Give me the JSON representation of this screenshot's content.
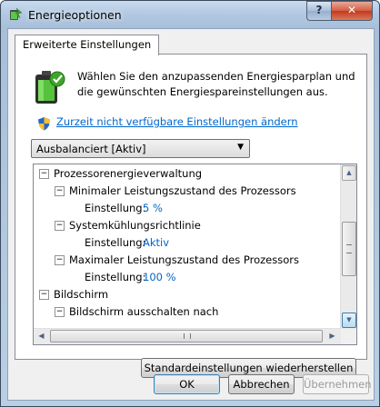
{
  "window": {
    "title": "Energieoptionen",
    "icon": "power-options-icon",
    "help_label": "?",
    "close_label": "✕"
  },
  "tab": {
    "label": "Erweiterte Einstellungen"
  },
  "intro": {
    "icon": "battery-icon",
    "text": "Wählen Sie den anzupassenden Energiesparplan und die gewünschten Energiespareinstellungen aus."
  },
  "admin_link": {
    "icon": "uac-shield-icon",
    "text": "Zurzeit nicht verfügbare Einstellungen ändern"
  },
  "plan_select": {
    "value": "Ausbalanciert [Aktiv]"
  },
  "tree": {
    "rows": [
      {
        "level": 0,
        "toggle": "⊟",
        "label": "Prozessorenergieverwaltung"
      },
      {
        "level": 1,
        "toggle": "⊟",
        "label": "Minimaler Leistungszustand des Prozessors"
      },
      {
        "level": 2,
        "toggle": "",
        "label": "Einstellung:",
        "value": "5 %"
      },
      {
        "level": 1,
        "toggle": "⊟",
        "label": "Systemkühlungsrichtlinie"
      },
      {
        "level": 2,
        "toggle": "",
        "label": "Einstellung:",
        "value": "Aktiv"
      },
      {
        "level": 1,
        "toggle": "⊟",
        "label": "Maximaler Leistungszustand des Prozessors"
      },
      {
        "level": 2,
        "toggle": "",
        "label": "Einstellung:",
        "value": "100 %"
      },
      {
        "level": 0,
        "toggle": "⊟",
        "label": "Bildschirm"
      },
      {
        "level": 1,
        "toggle": "⊟",
        "label": "Bildschirm ausschalten nach"
      }
    ]
  },
  "buttons": {
    "restore": "Standardeinstellungen wiederherstellen",
    "ok": "OK",
    "cancel": "Abbrechen",
    "apply": "Übernehmen"
  },
  "colors": {
    "link": "#0066cc",
    "value": "#0066cc"
  }
}
